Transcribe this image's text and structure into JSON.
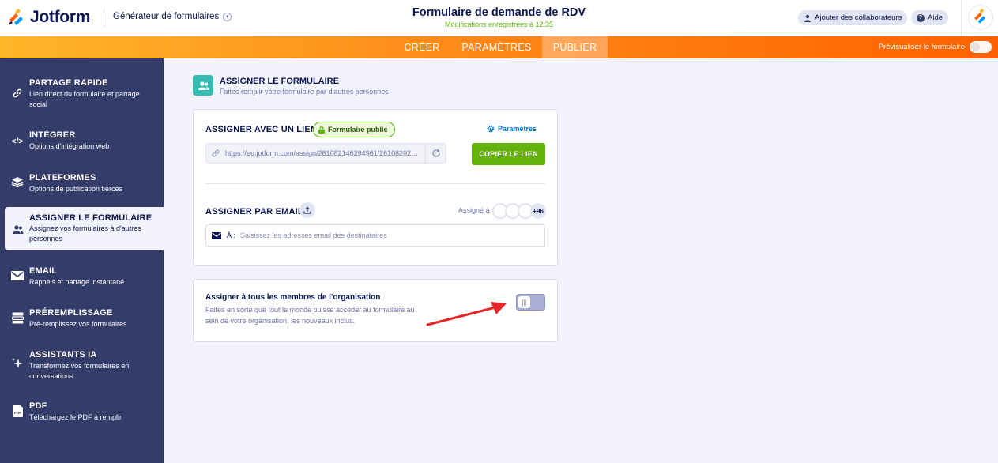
{
  "header": {
    "brand": "Jotform",
    "builder_switch": "Générateur de formulaires",
    "form_title": "Formulaire de demande de RDV",
    "saved_status": "Modifications enregistrées à 12:35",
    "add_collaborators": "Ajouter des collaborateurs",
    "help": "Aide"
  },
  "nav": {
    "tabs": [
      {
        "label": "CRÉER",
        "active": false
      },
      {
        "label": "PARAMÈTRES",
        "active": false
      },
      {
        "label": "PUBLIER",
        "active": true
      }
    ],
    "preview_label": "Prévisualiser le formulaire"
  },
  "sidebar": {
    "items": [
      {
        "title": "PARTAGE RAPIDE",
        "subtitle": "Lien direct du formulaire et partage social",
        "icon": "link-icon"
      },
      {
        "title": "INTÉGRER",
        "subtitle": "Options d'intégration web",
        "icon": "code-icon"
      },
      {
        "title": "PLATEFORMES",
        "subtitle": "Options de publication tierces",
        "icon": "layers-icon"
      },
      {
        "title": "ASSIGNER LE FORMULAIRE",
        "subtitle": "Assignez vos formulaires à d'autres personnes",
        "icon": "users-icon",
        "active": true
      },
      {
        "title": "EMAIL",
        "subtitle": "Rappels et partage instantané",
        "icon": "envelope-icon"
      },
      {
        "title": "PRÉREMPLISSAGE",
        "subtitle": "Pré-remplissez vos formulaires",
        "icon": "prefill-icon"
      },
      {
        "title": "ASSISTANTS IA",
        "subtitle": "Transformez vos formulaires en conversations",
        "icon": "sparkle-icon"
      },
      {
        "title": "PDF",
        "subtitle": "Téléchargez le PDF à remplir",
        "icon": "pdf-icon"
      }
    ]
  },
  "main": {
    "title": "ASSIGNER LE FORMULAIRE",
    "subtitle": "Faites remplir votre formulaire par d'autres personnes",
    "link_section": {
      "title": "ASSIGNER AVEC UN LIEN",
      "badge": "Formulaire public",
      "settings": "Paramètres",
      "url": "https://eu.jotform.com/assign/261082146294961/2610820255...",
      "copy_button": "COPIER LE LIEN"
    },
    "email_section": {
      "title": "ASSIGNER PAR EMAIL",
      "assigned_label": "Assigné à",
      "assigned_more": "+96",
      "to_label": "À :",
      "email_placeholder": "Saisissez les adresses email des destinataires"
    },
    "org_section": {
      "title": "Assigner à tous les membres de l'organisation",
      "description": "Faites en sorte que tout le monde puisse accéder au formulaire au sein de votre organisation, les nouveaux inclus.",
      "enabled": false
    }
  },
  "colors": {
    "nav_gradient_start": "#ffb629",
    "nav_gradient_end": "#ff6100",
    "sidebar_bg": "#343c6a",
    "accent_green": "#64b20b",
    "accent_teal": "#34bbb2",
    "annotation_arrow": "#e8262a"
  }
}
